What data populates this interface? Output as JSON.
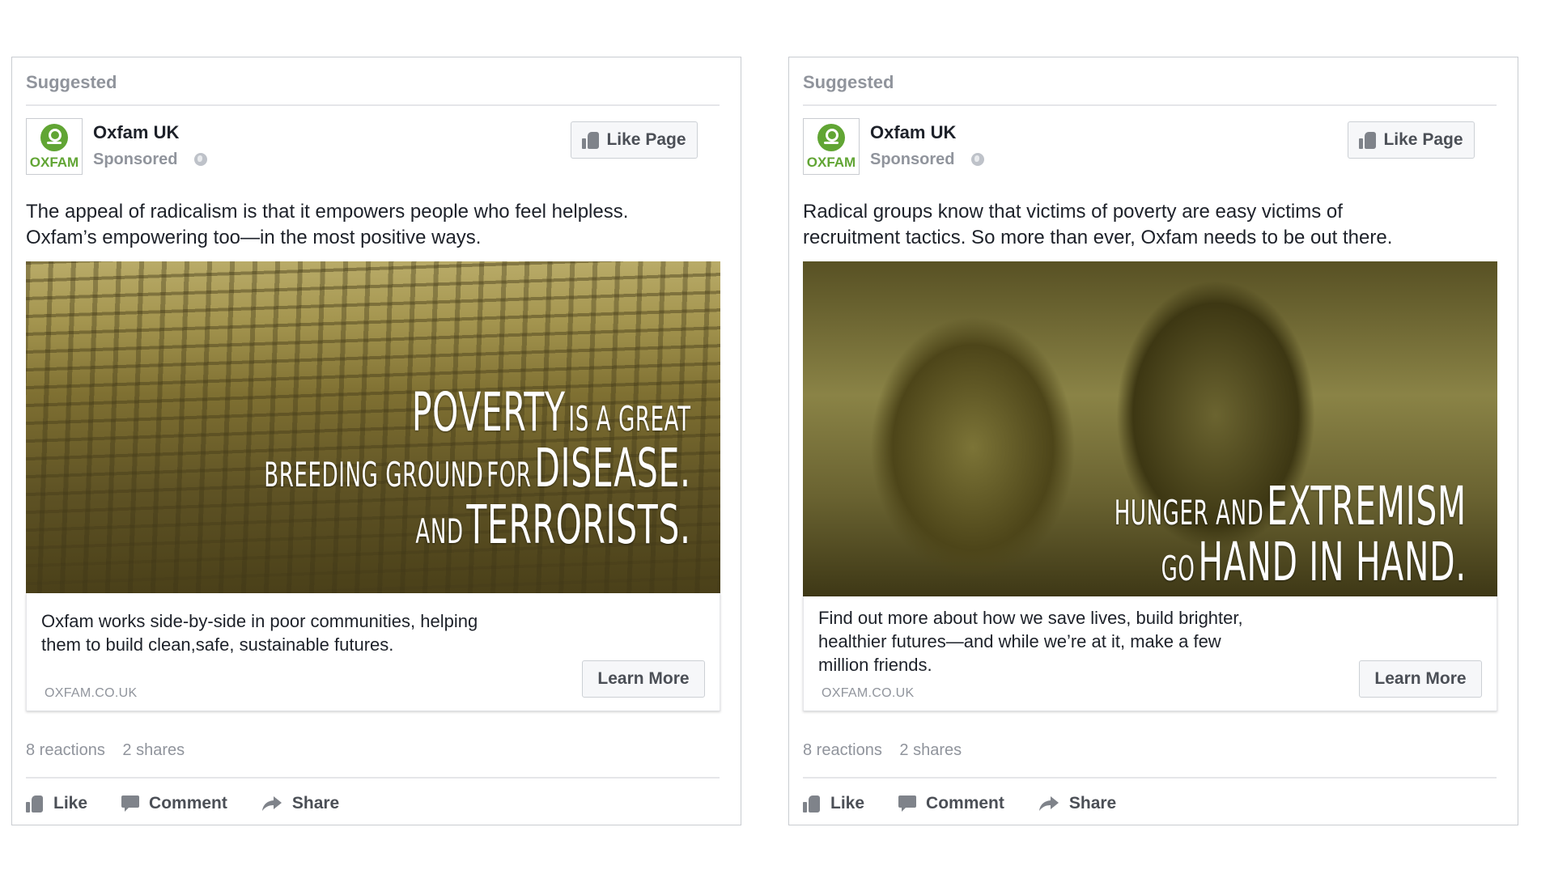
{
  "cards": [
    {
      "suggested_label": "Suggested",
      "page_name": "Oxfam UK",
      "sponsored_label": "Sponsored",
      "logo_text": "OXFAM",
      "like_page_label": "Like Page",
      "post_text_line1": "The appeal of radicalism is that it empowers people who feel helpless.",
      "post_text_line2": "Oxfam’s empowering too—in the most positive ways.",
      "overlay": {
        "line1_big": "POVERTY",
        "line1_small": "IS A GREAT",
        "line2_small_a": "BREEDING GROUND",
        "line2_small_b": "FOR",
        "line2_big": "DISEASE.",
        "line3_small": "AND",
        "line3_big": "TERRORISTS."
      },
      "link_description_line1": "Oxfam works side-by-side in poor communities, helping",
      "link_description_line2": "them to build clean,safe, sustainable futures.",
      "link_domain": "OXFAM.CO.UK",
      "learn_more_label": "Learn More",
      "reactions": "8 reactions",
      "shares": "2 shares",
      "actions": {
        "like": "Like",
        "comment": "Comment",
        "share": "Share"
      }
    },
    {
      "suggested_label": "Suggested",
      "page_name": "Oxfam UK",
      "sponsored_label": "Sponsored",
      "logo_text": "OXFAM",
      "like_page_label": "Like Page",
      "post_text_line1": "Radical groups know that victims of poverty are easy victims of",
      "post_text_line2": "recruitment tactics. So more than ever, Oxfam needs to be out there.",
      "overlay": {
        "line1_small": "HUNGER AND",
        "line1_big": "EXTREMISM",
        "line2_small": "GO",
        "line2_big": "HAND IN HAND."
      },
      "link_description_line1": "Find out more about how we save lives, build brighter,",
      "link_description_line2": "healthier futures—and while we’re at it, make a few",
      "link_description_line3": "million friends.",
      "link_domain": "OXFAM.CO.UK",
      "learn_more_label": "Learn More",
      "reactions": "8 reactions",
      "shares": "2 shares",
      "actions": {
        "like": "Like",
        "comment": "Comment",
        "share": "Share"
      }
    }
  ],
  "colors": {
    "oxfam_green": "#61a534",
    "muted_text": "#90949c",
    "button_text": "#4b4f56",
    "body_text": "#1d2129"
  }
}
